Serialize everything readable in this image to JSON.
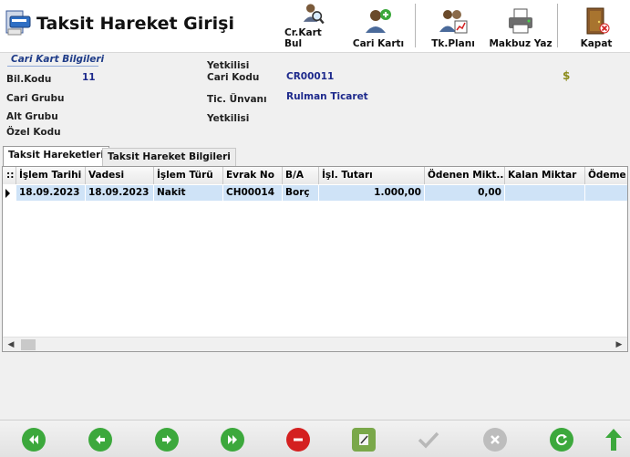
{
  "window": {
    "title": "Taksit Hareket Girişi"
  },
  "toolbar": {
    "buttons": [
      {
        "label": "Cr.Kart Bul",
        "icon": "user-search-icon"
      },
      {
        "label": "Cari Kartı",
        "icon": "user-add-icon"
      },
      {
        "label": "Tk.Planı",
        "icon": "users-chart-icon"
      },
      {
        "label": "Makbuz Yaz",
        "icon": "printer-icon"
      },
      {
        "label": "Kapat",
        "icon": "door-exit-icon"
      }
    ]
  },
  "info": {
    "caption": "Cari Kart Bilgileri",
    "bil_kodu_label": "Bil.Kodu",
    "bil_kodu_value": "11",
    "cari_grubu_label": "Cari Grubu",
    "alt_grubu_label": "Alt Grubu",
    "ozel_kodu_label": "Özel Kodu",
    "yetkilisi_top_label": "Yetkilisi",
    "cari_kodu_label": "Cari Kodu",
    "cari_kodu_value": "CR00011",
    "tic_unvani_label": "Tic. Ünvanı",
    "tic_unvani_value": "Rulman Ticaret",
    "yetkilisi_label": "Yetkilisi",
    "currency_symbol": "$"
  },
  "tabs": [
    {
      "label": "Taksit Hareketleri",
      "active": true
    },
    {
      "label": "Taksit Hareket Bilgileri",
      "active": false
    }
  ],
  "grid": {
    "corner": "::",
    "columns": [
      "İşlem Tarihi",
      "Vadesi",
      "İşlem Türü",
      "Evrak No",
      "B/A",
      "İşl. Tutarı",
      "Ödenen Mikt...",
      "Kalan Miktar",
      "Ödeme"
    ],
    "rows": [
      [
        "18.09.2023",
        "18.09.2023",
        "Nakit",
        "CH00014",
        "Borç",
        "1.000,00",
        "0,00",
        "",
        ""
      ]
    ]
  },
  "nav": {
    "buttons": [
      "first-icon",
      "previous-icon",
      "next-icon",
      "last-icon",
      "delete-icon",
      "edit-icon",
      "confirm-icon",
      "cancel-icon",
      "refresh-icon",
      "up-arrow-icon"
    ]
  },
  "colors": {
    "accent_blue": "#1e2a8c",
    "selected_row": "#cfe3f7",
    "nav_green": "#3ca83c",
    "nav_red": "#d42020"
  }
}
